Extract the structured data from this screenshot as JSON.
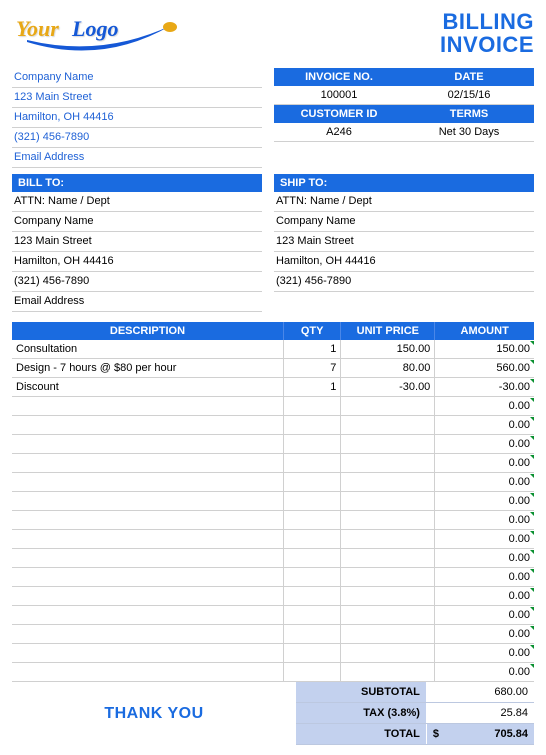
{
  "logo": {
    "word1": "Your",
    "word2": "Logo"
  },
  "title": {
    "line1": "BILLING",
    "line2": "INVOICE"
  },
  "company": {
    "name": "Company Name",
    "street": "123 Main Street",
    "city": "Hamilton, OH  44416",
    "phone": "(321) 456-7890",
    "email": "Email Address"
  },
  "meta": {
    "invoice_no_label": "INVOICE NO.",
    "date_label": "DATE",
    "invoice_no": "100001",
    "date": "02/15/16",
    "customer_id_label": "CUSTOMER ID",
    "terms_label": "TERMS",
    "customer_id": "A246",
    "terms": "Net 30 Days"
  },
  "bill_to_label": "BILL TO:",
  "ship_to_label": "SHIP TO:",
  "bill_to": {
    "attn": "ATTN: Name / Dept",
    "company": "Company Name",
    "street": "123 Main Street",
    "city": "Hamilton, OH  44416",
    "phone": "(321) 456-7890",
    "email": "Email Address"
  },
  "ship_to": {
    "attn": "ATTN: Name / Dept",
    "company": "Company Name",
    "street": "123 Main Street",
    "city": "Hamilton, OH  44416",
    "phone": "(321) 456-7890"
  },
  "columns": {
    "description": "DESCRIPTION",
    "qty": "QTY",
    "unit_price": "UNIT PRICE",
    "amount": "AMOUNT"
  },
  "lines": [
    {
      "desc": "Consultation",
      "qty": "1",
      "unit": "150.00",
      "amount": "150.00"
    },
    {
      "desc": "Design - 7 hours @ $80 per hour",
      "qty": "7",
      "unit": "80.00",
      "amount": "560.00"
    },
    {
      "desc": "Discount",
      "qty": "1",
      "unit": "-30.00",
      "amount": "-30.00"
    },
    {
      "desc": "",
      "qty": "",
      "unit": "",
      "amount": "0.00"
    },
    {
      "desc": "",
      "qty": "",
      "unit": "",
      "amount": "0.00"
    },
    {
      "desc": "",
      "qty": "",
      "unit": "",
      "amount": "0.00"
    },
    {
      "desc": "",
      "qty": "",
      "unit": "",
      "amount": "0.00"
    },
    {
      "desc": "",
      "qty": "",
      "unit": "",
      "amount": "0.00"
    },
    {
      "desc": "",
      "qty": "",
      "unit": "",
      "amount": "0.00"
    },
    {
      "desc": "",
      "qty": "",
      "unit": "",
      "amount": "0.00"
    },
    {
      "desc": "",
      "qty": "",
      "unit": "",
      "amount": "0.00"
    },
    {
      "desc": "",
      "qty": "",
      "unit": "",
      "amount": "0.00"
    },
    {
      "desc": "",
      "qty": "",
      "unit": "",
      "amount": "0.00"
    },
    {
      "desc": "",
      "qty": "",
      "unit": "",
      "amount": "0.00"
    },
    {
      "desc": "",
      "qty": "",
      "unit": "",
      "amount": "0.00"
    },
    {
      "desc": "",
      "qty": "",
      "unit": "",
      "amount": "0.00"
    },
    {
      "desc": "",
      "qty": "",
      "unit": "",
      "amount": "0.00"
    },
    {
      "desc": "",
      "qty": "",
      "unit": "",
      "amount": "0.00"
    }
  ],
  "totals": {
    "subtotal_label": "SUBTOTAL",
    "subtotal": "680.00",
    "tax_label": "TAX (3.8%)",
    "tax": "25.84",
    "total_label": "TOTAL",
    "currency": "$",
    "total": "705.84"
  },
  "thank_you": "THANK YOU"
}
